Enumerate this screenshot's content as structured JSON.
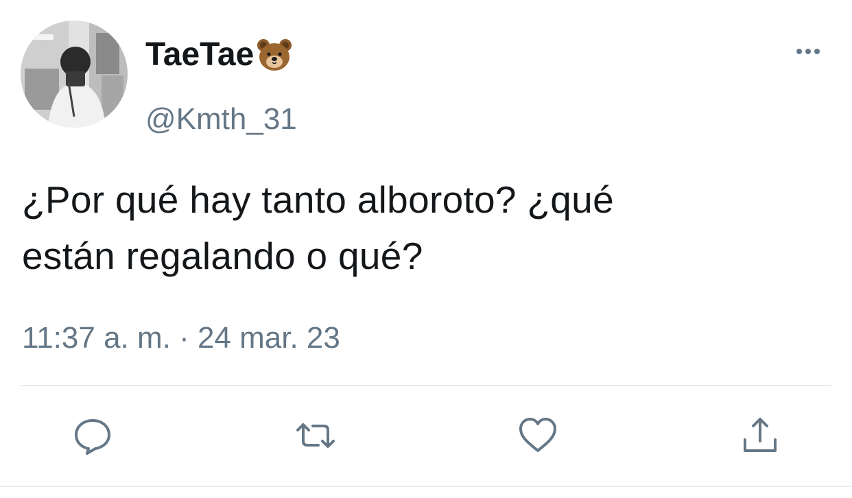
{
  "user": {
    "display_name": "TaeTae",
    "name_emoji": "bear-face",
    "handle": "@Kmth_31",
    "avatar": "avatar-photo"
  },
  "tweet": {
    "text_line1": "¿Por qué hay tanto alboroto? ¿qué",
    "text_line2": "están regalando o qué?",
    "timestamp": "11:37 a. m. · 24 mar. 23"
  },
  "actions": [
    {
      "name": "reply",
      "icon": "comment-icon"
    },
    {
      "name": "retweet",
      "icon": "retweet-icon"
    },
    {
      "name": "like",
      "icon": "heart-icon"
    },
    {
      "name": "share",
      "icon": "share-icon"
    }
  ],
  "colors": {
    "text": "#14171a",
    "secondary": "#657786",
    "divider": "#e6ecf0",
    "icon": "#657786"
  }
}
